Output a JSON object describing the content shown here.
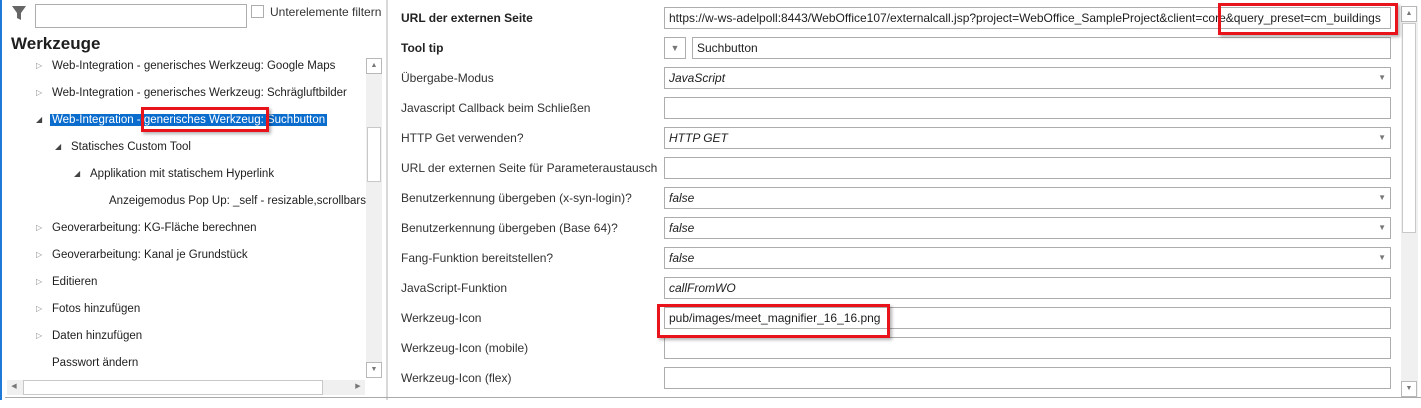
{
  "left": {
    "filter_placeholder": "",
    "filter_children_label": "Unterelemente filtern",
    "title": "Werkzeuge",
    "tree": [
      {
        "label": "Web-Integration - generisches Werkzeug: Google Maps",
        "level": 1,
        "state": "collapsed"
      },
      {
        "label": "Web-Integration - generisches Werkzeug: Schrägluftbilder",
        "level": 1,
        "state": "collapsed"
      },
      {
        "label": "Web-Integration - generisches Werkzeug: Suchbutton",
        "level": 1,
        "state": "expanded",
        "selected": true
      },
      {
        "label": "Statisches Custom Tool",
        "level": 2,
        "state": "expanded"
      },
      {
        "label": "Applikation mit statischem Hyperlink",
        "level": 3,
        "state": "expanded"
      },
      {
        "label": "Anzeigemodus Pop Up: _self - resizable,scrollbars",
        "level": 4,
        "state": "leaf"
      },
      {
        "label": "Geoverarbeitung: KG-Fläche berechnen",
        "level": 1,
        "state": "collapsed"
      },
      {
        "label": "Geoverarbeitung: Kanal je Grundstück",
        "level": 1,
        "state": "collapsed"
      },
      {
        "label": "Editieren",
        "level": 1,
        "state": "collapsed"
      },
      {
        "label": "Fotos hinzufügen",
        "level": 1,
        "state": "collapsed"
      },
      {
        "label": "Daten hinzufügen",
        "level": 1,
        "state": "collapsed"
      },
      {
        "label": "Passwort ändern",
        "level": 1,
        "state": "leaf"
      }
    ]
  },
  "properties": [
    {
      "label": "URL der externen Seite",
      "value": "https://w-ws-adelpoll:8443/WebOffice107/externalcall.jsp?project=WebOffice_SampleProject&client=core&query_preset=cm_buildings",
      "type": "text",
      "bold": true
    },
    {
      "label": "Tool tip",
      "value": "Suchbutton",
      "type": "tooltip",
      "bold": true
    },
    {
      "label": "Übergabe-Modus",
      "value": "JavaScript",
      "type": "select"
    },
    {
      "label": "Javascript Callback beim Schließen",
      "value": "",
      "type": "text"
    },
    {
      "label": "HTTP Get verwenden?",
      "value": "HTTP GET",
      "type": "select"
    },
    {
      "label": "URL der externen Seite für Parameteraustausch",
      "value": "",
      "type": "text"
    },
    {
      "label": "Benutzerkennung übergeben (x-syn-login)?",
      "value": "false",
      "type": "select"
    },
    {
      "label": "Benutzerkennung übergeben (Base 64)?",
      "value": "false",
      "type": "select"
    },
    {
      "label": "Fang-Funktion bereitstellen?",
      "value": "false",
      "type": "select"
    },
    {
      "label": "JavaScript-Funktion",
      "value": "callFromWO",
      "type": "italic"
    },
    {
      "label": "Werkzeug-Icon",
      "value": "pub/images/meet_magnifier_16_16.png",
      "type": "text"
    },
    {
      "label": "Werkzeug-Icon (mobile)",
      "value": "",
      "type": "text"
    },
    {
      "label": "Werkzeug-Icon (flex)",
      "value": "",
      "type": "text"
    }
  ],
  "colors": {
    "selection": "#0a6ccc",
    "highlight": "#e8131b"
  }
}
